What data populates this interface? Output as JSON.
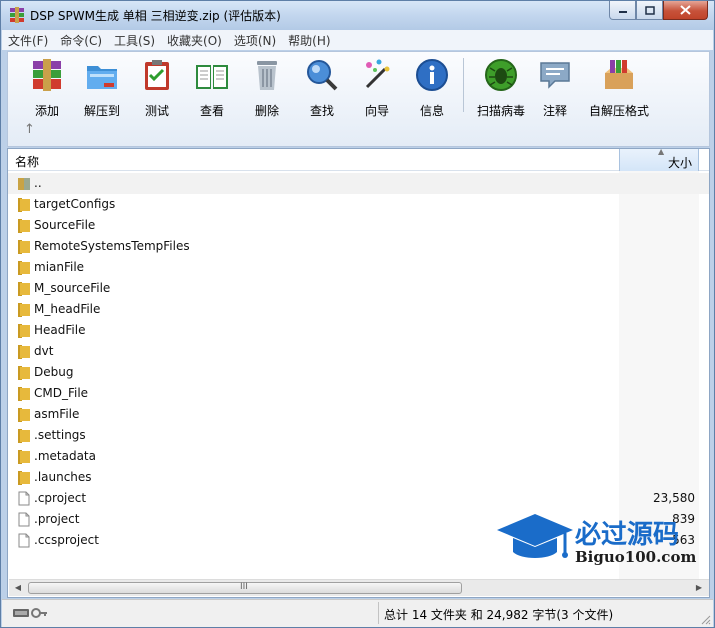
{
  "window": {
    "title": "DSP SPWM生成 单相 三相逆变.zip (评估版本)"
  },
  "menu": [
    "文件(F)",
    "命令(C)",
    "工具(S)",
    "收藏夹(O)",
    "选项(N)",
    "帮助(H)"
  ],
  "toolbar": {
    "add": "添加",
    "extract": "解压到",
    "test": "测试",
    "view": "查看",
    "delete": "删除",
    "find": "查找",
    "wizard": "向导",
    "info": "信息",
    "scan": "扫描病毒",
    "comment": "注释",
    "sfx": "自解压格式",
    "up_arrow": "↑"
  },
  "columns": {
    "name": "名称",
    "size": "大小"
  },
  "files": [
    {
      "name": "..",
      "type": "parent",
      "size": ""
    },
    {
      "name": "targetConfigs",
      "type": "folder",
      "size": ""
    },
    {
      "name": "SourceFile",
      "type": "folder",
      "size": ""
    },
    {
      "name": "RemoteSystemsTempFiles",
      "type": "folder",
      "size": ""
    },
    {
      "name": "mianFile",
      "type": "folder",
      "size": ""
    },
    {
      "name": "M_sourceFile",
      "type": "folder",
      "size": ""
    },
    {
      "name": "M_headFile",
      "type": "folder",
      "size": ""
    },
    {
      "name": "HeadFile",
      "type": "folder",
      "size": ""
    },
    {
      "name": "dvt",
      "type": "folder",
      "size": ""
    },
    {
      "name": "Debug",
      "type": "folder",
      "size": ""
    },
    {
      "name": "CMD_File",
      "type": "folder",
      "size": ""
    },
    {
      "name": "asmFile",
      "type": "folder",
      "size": ""
    },
    {
      "name": ".settings",
      "type": "folder",
      "size": ""
    },
    {
      "name": ".metadata",
      "type": "folder",
      "size": ""
    },
    {
      "name": ".launches",
      "type": "folder",
      "size": ""
    },
    {
      "name": ".cproject",
      "type": "file",
      "size": "23,580"
    },
    {
      "name": ".project",
      "type": "file",
      "size": "839"
    },
    {
      "name": ".ccsproject",
      "type": "file",
      "size": "563"
    }
  ],
  "watermark": {
    "title": "必过源码",
    "subtitle": "Biguo100.com"
  },
  "scrollbar": {
    "grip": "III"
  },
  "status": {
    "text": "总计 14 文件夹 和 24,982 字节(3 个文件)"
  },
  "colors": {
    "folder": "#e7b93c",
    "accent": "#1a6cc9",
    "titlebar": "#c2d6ee"
  }
}
